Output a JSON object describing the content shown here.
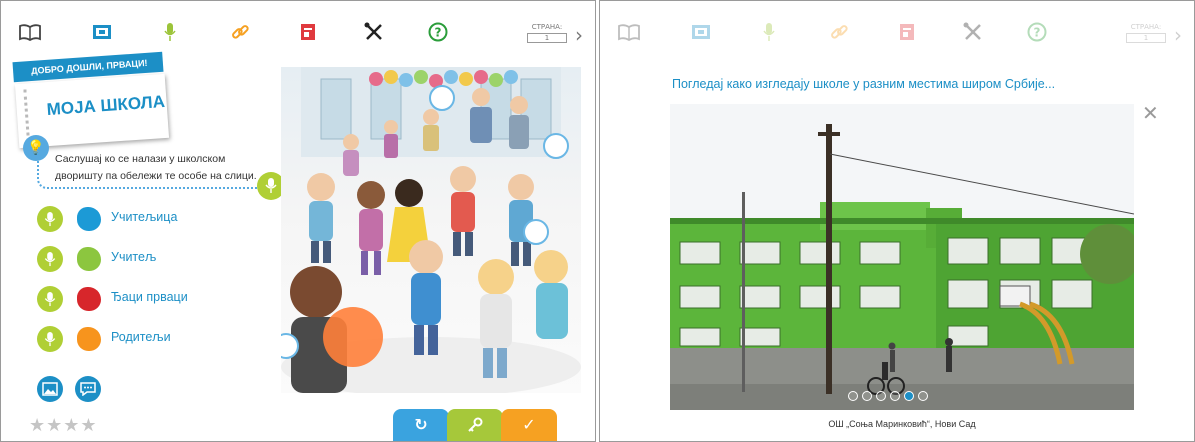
{
  "left_screen": {
    "toolbar": {
      "icons": [
        "book-icon",
        "film-icon",
        "microphone-icon",
        "link-icon",
        "document-icon",
        "tools-icon",
        "help-icon"
      ],
      "page_label": "СТРАНА:",
      "page_number": "1"
    },
    "banner": {
      "subtitle": "ДОБРО ДОШЛИ, ПРВАЦИ!",
      "title": "МОЈА ШКОЛА"
    },
    "instruction": "Саслушај ко се налази у школском дворишту па обележи те особе на слици.",
    "legend": [
      {
        "label": "Учитељица",
        "color": "#1c9ad6"
      },
      {
        "label": "Учитељ",
        "color": "#8cc63f"
      },
      {
        "label": "Ђаци прваци",
        "color": "#d7262b"
      },
      {
        "label": "Родитељи",
        "color": "#f7941d"
      }
    ],
    "rating_stars": "★★★★",
    "actions": {
      "reset": "↻",
      "hint": "🔑",
      "check": "✓"
    },
    "colors": {
      "accent": "#1c8fc6",
      "mic_green": "#b0cf35",
      "reset_blue": "#3aa3df",
      "hint_green": "#a6c83a",
      "check_orange": "#f6a122"
    }
  },
  "right_screen": {
    "toolbar": {
      "icons": [
        "book-icon",
        "film-icon",
        "microphone-icon",
        "link-icon",
        "document-icon",
        "tools-icon",
        "help-icon"
      ],
      "page_label": "СТРАНА:",
      "page_number": "1"
    },
    "caption": "Погледај како изгледају школе у разним местима широм Србије...",
    "photo_caption": "ОШ „Соња Маринковић“, Нови Сад",
    "carousel": {
      "count": 6,
      "active_index": 4
    }
  }
}
